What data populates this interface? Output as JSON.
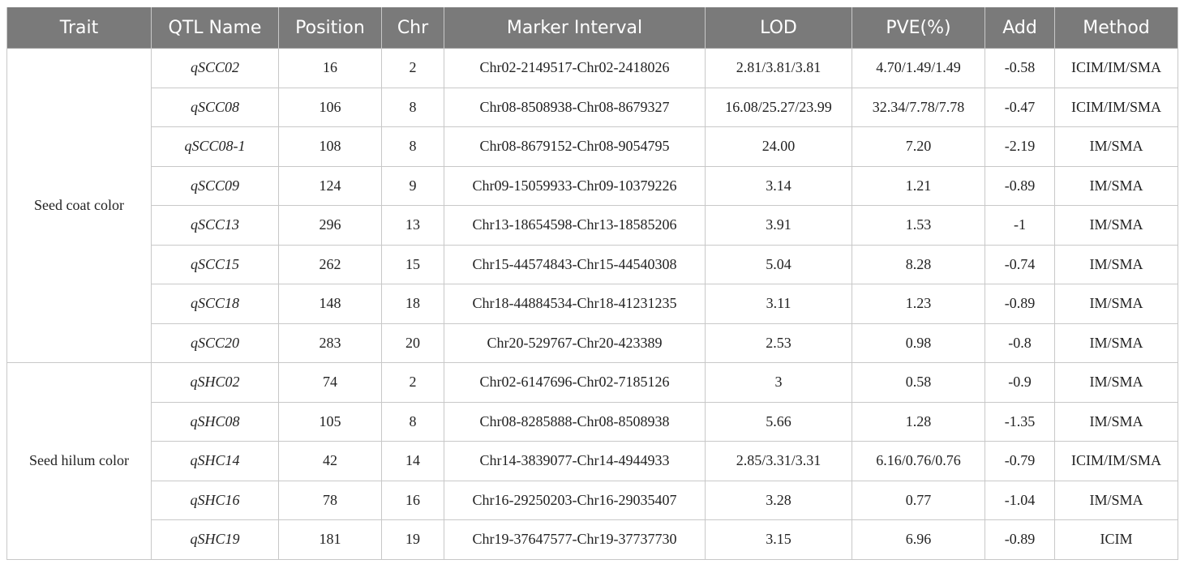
{
  "table": {
    "headers": [
      "Trait",
      "QTL Name",
      "Position",
      "Chr",
      "Marker Interval",
      "LOD",
      "PVE(%)",
      "Add",
      "Method"
    ],
    "groups": [
      {
        "trait": "Seed coat color",
        "rows": [
          {
            "qtl": "qSCC02",
            "position": "16",
            "chr": "2",
            "marker": "Chr02-2149517-Chr02-2418026",
            "lod": "2.81/3.81/3.81",
            "pve": "4.70/1.49/1.49",
            "add": "-0.58",
            "method": "ICIM/IM/SMA"
          },
          {
            "qtl": "qSCC08",
            "position": "106",
            "chr": "8",
            "marker": "Chr08-8508938-Chr08-8679327",
            "lod": "16.08/25.27/23.99",
            "pve": "32.34/7.78/7.78",
            "add": "-0.47",
            "method": "ICIM/IM/SMA"
          },
          {
            "qtl": "qSCC08-1",
            "position": "108",
            "chr": "8",
            "marker": "Chr08-8679152-Chr08-9054795",
            "lod": "24.00",
            "pve": "7.20",
            "add": "-2.19",
            "method": "IM/SMA"
          },
          {
            "qtl": "qSCC09",
            "position": "124",
            "chr": "9",
            "marker": "Chr09-15059933-Chr09-10379226",
            "lod": "3.14",
            "pve": "1.21",
            "add": "-0.89",
            "method": "IM/SMA"
          },
          {
            "qtl": "qSCC13",
            "position": "296",
            "chr": "13",
            "marker": "Chr13-18654598-Chr13-18585206",
            "lod": "3.91",
            "pve": "1.53",
            "add": "-1",
            "method": "IM/SMA"
          },
          {
            "qtl": "qSCC15",
            "position": "262",
            "chr": "15",
            "marker": "Chr15-44574843-Chr15-44540308",
            "lod": "5.04",
            "pve": "8.28",
            "add": "-0.74",
            "method": "IM/SMA"
          },
          {
            "qtl": "qSCC18",
            "position": "148",
            "chr": "18",
            "marker": "Chr18-44884534-Chr18-41231235",
            "lod": "3.11",
            "pve": "1.23",
            "add": "-0.89",
            "method": "IM/SMA"
          },
          {
            "qtl": "qSCC20",
            "position": "283",
            "chr": "20",
            "marker": "Chr20-529767-Chr20-423389",
            "lod": "2.53",
            "pve": "0.98",
            "add": "-0.8",
            "method": "IM/SMA"
          }
        ]
      },
      {
        "trait": "Seed hilum color",
        "rows": [
          {
            "qtl": "qSHC02",
            "position": "74",
            "chr": "2",
            "marker": "Chr02-6147696-Chr02-7185126",
            "lod": "3",
            "pve": "0.58",
            "add": "-0.9",
            "method": "IM/SMA"
          },
          {
            "qtl": "qSHC08",
            "position": "105",
            "chr": "8",
            "marker": "Chr08-8285888-Chr08-8508938",
            "lod": "5.66",
            "pve": "1.28",
            "add": "-1.35",
            "method": "IM/SMA"
          },
          {
            "qtl": "qSHC14",
            "position": "42",
            "chr": "14",
            "marker": "Chr14-3839077-Chr14-4944933",
            "lod": "2.85/3.31/3.31",
            "pve": "6.16/0.76/0.76",
            "add": "-0.79",
            "method": "ICIM/IM/SMA"
          },
          {
            "qtl": "qSHC16",
            "position": "78",
            "chr": "16",
            "marker": "Chr16-29250203-Chr16-29035407",
            "lod": "3.28",
            "pve": "0.77",
            "add": "-1.04",
            "method": "IM/SMA"
          },
          {
            "qtl": "qSHC19",
            "position": "181",
            "chr": "19",
            "marker": "Chr19-37647577-Chr19-37737730",
            "lod": "3.15",
            "pve": "6.96",
            "add": "-0.89",
            "method": "ICIM"
          }
        ]
      }
    ]
  }
}
